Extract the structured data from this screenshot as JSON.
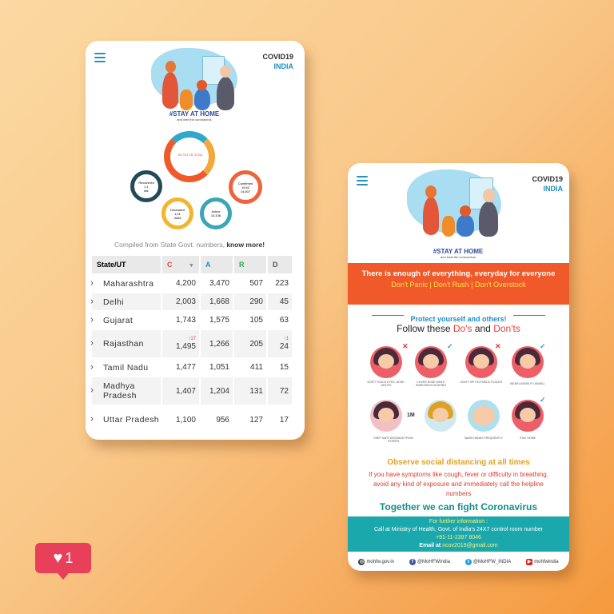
{
  "colors": {
    "accent": "#1a8fc2",
    "banner": "#f05a2b",
    "teal": "#1ba8ad",
    "confirmed": "#e8413a",
    "active": "#1a8fc2",
    "recovered": "#2fa84f",
    "notify": "#e8405a"
  },
  "left_phone": {
    "brand_line1": "COVID19",
    "brand_line2": "INDIA",
    "hero_tagline": "#STAY AT HOME",
    "hero_subtext": "and limit the coronavirus",
    "graph": {
      "center": "24 Act 10 4,011",
      "node_left": [
        "Recovered",
        "1,1",
        "Ind."
      ],
      "node_bottom": [
        "Deceased",
        "1,01",
        "India"
      ],
      "node_right_bottom": [
        "Active",
        "13,106"
      ],
      "node_right": [
        "Confirmed",
        "19,62",
        "14,607"
      ]
    },
    "compiled_text": "Compiled from State Govt. numbers,",
    "know_more": "know more!",
    "table": {
      "headers": {
        "state": "State/UT",
        "c": "C",
        "a": "A",
        "r": "R",
        "d": "D"
      },
      "rows": [
        {
          "state": "Maharashtra",
          "c": "4,200",
          "a": "3,470",
          "r": "507",
          "d": "223"
        },
        {
          "state": "Delhi",
          "c": "2,003",
          "a": "1,668",
          "r": "290",
          "d": "45"
        },
        {
          "state": "Gujarat",
          "c": "1,743",
          "a": "1,575",
          "r": "105",
          "d": "63"
        },
        {
          "state": "Rajasthan",
          "c_delta": "↑17",
          "c": "1,495",
          "a": "1,266",
          "r": "205",
          "d_delta": "↑1",
          "d": "24"
        },
        {
          "state": "Tamil Nadu",
          "c": "1,477",
          "a": "1,051",
          "r": "411",
          "d": "15"
        },
        {
          "state": "Madhya Pradesh",
          "c": "1,407",
          "a": "1,204",
          "r": "131",
          "d": "72"
        },
        {
          "state": "Uttar Pradesh",
          "c": "1,100",
          "a": "956",
          "r": "127",
          "d": "17"
        }
      ]
    }
  },
  "right_phone": {
    "brand_line1": "COVID19",
    "brand_line2": "INDIA",
    "hero_tagline": "#STAY AT HOME",
    "hero_subtext": "and beat the coronavirus",
    "banner_line1": "There is enough of everything, everyday for everyone",
    "banner_line2": "Don't Panic | Don't Rush | Don't Overstock",
    "protect": "Protect yourself and others!",
    "follow_pre": "Follow these ",
    "follow_dos": "Do's",
    "follow_and": " and ",
    "follow_donts": "Don'ts",
    "tips": [
      {
        "caption": "DON'T TOUCH EYES, NOSE, MOUTH",
        "mark": "✕"
      },
      {
        "caption": "COVER NOSE WHILE SNEEZING/COUGHING",
        "mark": "✓"
      },
      {
        "caption": "DON'T SPIT IN PUBLIC PLACES",
        "mark": "✕"
      },
      {
        "caption": "WEAR A MASK IF UNWELL",
        "mark": "✓"
      },
      {
        "caption": "KEEP SAFE DISTANCE FROM OTHERS",
        "mark": ""
      },
      {
        "caption": "WASH HANDS FREQUENTLY",
        "mark": ""
      },
      {
        "caption": "STAY HOME",
        "mark": "✓"
      }
    ],
    "distance_label": "1M",
    "social_distancing": "Observe social distancing at all times",
    "symptoms": "If you have symptoms like cough, fever or difficulty in breathing, avoid any kind of exposure and immediately call the helpline numbers",
    "together": "Together we can fight Coronavirus",
    "contact_head": "For further information :",
    "contact_line": "Call at Ministry of Health, Govt. of India's 24X7 control room number",
    "contact_number": "+91-11-2397 8046",
    "contact_email_label": "Email at ",
    "contact_email": "ncov2019@gmail.com",
    "footer": [
      {
        "icon": "globe-icon",
        "label": "mohfw.gov.in"
      },
      {
        "icon": "facebook-icon",
        "label": "@MoHFWIndia"
      },
      {
        "icon": "twitter-icon",
        "label": "@MoHFW_INDIA"
      },
      {
        "icon": "youtube-icon",
        "label": "mohfwindia"
      }
    ]
  },
  "notification": {
    "icon": "heart-icon",
    "count": "1"
  }
}
